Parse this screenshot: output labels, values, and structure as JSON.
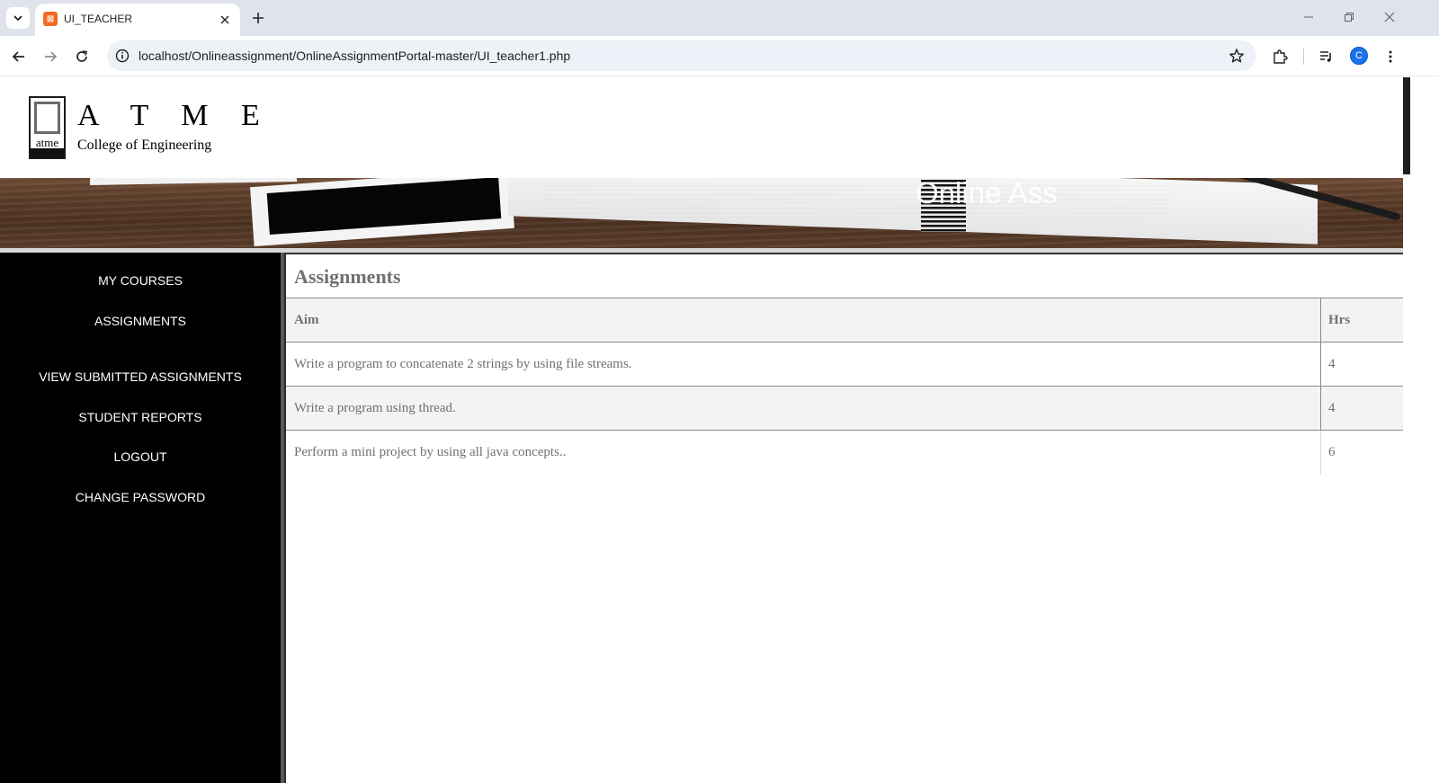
{
  "browser": {
    "tab_title": "UI_TEACHER",
    "url": "localhost/Onlineassignment/OnlineAssignmentPortal-master/UI_teacher1.php",
    "profile_initial": "C"
  },
  "header": {
    "logo_name": "A T M E",
    "logo_subtitle": "College of Engineering",
    "logo_mark_text": "atme"
  },
  "banner": {
    "title": "Online Ass"
  },
  "sidebar": {
    "items": [
      {
        "label": "MY COURSES"
      },
      {
        "label": "ASSIGNMENTS"
      },
      {
        "label": "VIEW SUBMITTED ASSIGNMENTS"
      },
      {
        "label": "STUDENT REPORTS"
      },
      {
        "label": "LOGOUT"
      },
      {
        "label": "CHANGE PASSWORD"
      }
    ]
  },
  "main": {
    "title": "Assignments",
    "columns": [
      "Aim",
      "Hrs"
    ],
    "rows": [
      {
        "aim": "Write a program to concatenate 2 strings by using file streams.",
        "hrs": "4"
      },
      {
        "aim": "Write a program using thread.",
        "hrs": "4"
      },
      {
        "aim": "Perform a mini project by using all java concepts..",
        "hrs": "6"
      }
    ]
  },
  "colors": {
    "sidebar_bg": "#000000",
    "text_gray": "#707070",
    "accent": "#1a73e8"
  }
}
